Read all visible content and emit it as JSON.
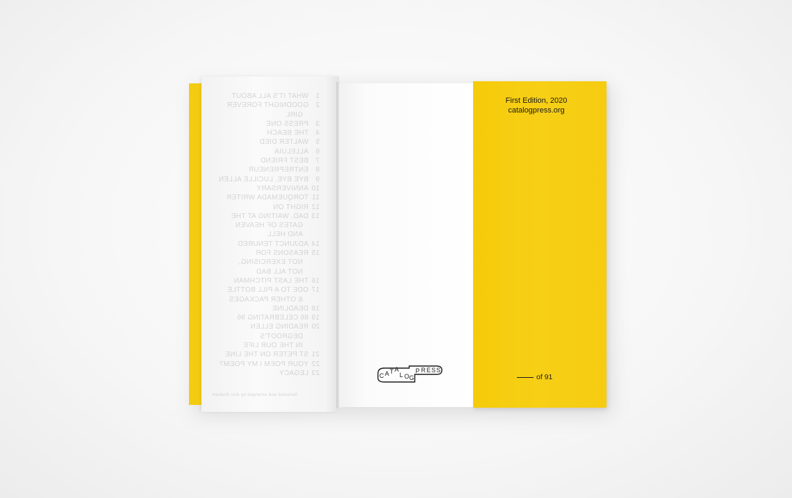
{
  "image": {
    "description_colors": {
      "background": "#f7f7f7",
      "cover_yellow": "#f5cc10",
      "paper": "#fbfbfb",
      "ink": "#1a1a1a"
    }
  },
  "colophon": {
    "edition": "First Edition, 2020",
    "website": "catalogpress.org",
    "copy_count_suffix": "of 91"
  },
  "logo": {
    "letters": [
      "C",
      "A",
      "T",
      "A",
      "L",
      "O",
      "G",
      "P",
      "R",
      "E",
      "S",
      "S"
    ]
  },
  "contents_showthrough": {
    "rows": [
      {
        "num": "1",
        "title": "WHAT IT'S ALL ABOUT"
      },
      {
        "num": "2",
        "title": "GOODNIGHT FOREVER"
      },
      {
        "num": "",
        "title": "GIRL"
      },
      {
        "num": "3",
        "title": "PRESS ONE"
      },
      {
        "num": "4",
        "title": "THE BEACH"
      },
      {
        "num": "5",
        "title": "WALTER DIED"
      },
      {
        "num": "6",
        "title": "ALLELUIA"
      },
      {
        "num": "7",
        "title": "BEST FRIEND"
      },
      {
        "num": "8",
        "title": "ENTREPRENEUR"
      },
      {
        "num": "9",
        "title": "BYE BYE, LUCILLE ALLEN"
      },
      {
        "num": "10",
        "title": "ANNIVERSARY"
      },
      {
        "num": "11",
        "title": "TORQUEMADA WRITER"
      },
      {
        "num": "12",
        "title": "RIGHT ON"
      },
      {
        "num": "13",
        "title": "DAD, WAITING AT THE"
      },
      {
        "num": "",
        "title": "GATES OF HEAVEN"
      },
      {
        "num": "",
        "title": "AND HELL"
      },
      {
        "num": "14",
        "title": "ADJUNCT TENURED"
      },
      {
        "num": "15",
        "title": "REASONS FOR"
      },
      {
        "num": "",
        "title": "NOT EXERCISING,"
      },
      {
        "num": "",
        "title": "NOT ALL BAD"
      },
      {
        "num": "16",
        "title": "THE LAST PITCHMAN"
      },
      {
        "num": "17",
        "title": "ODE TO A PILL BOTTLE"
      },
      {
        "num": "",
        "title": "& OTHER PACKAGES"
      },
      {
        "num": "18",
        "title": "DEADLINE"
      },
      {
        "num": "19",
        "title": "86 CELEBRATING 96"
      },
      {
        "num": "20",
        "title": "READING ELLEN"
      },
      {
        "num": "",
        "title": "DEGROOT'S"
      },
      {
        "num": "",
        "title": "IN THE OUR LIFE"
      },
      {
        "num": "21",
        "title": "ST PETER ON THE LINE"
      },
      {
        "num": "22",
        "title": "YOUR POEM I MY POEM?"
      },
      {
        "num": "23",
        "title": "LEGACY"
      }
    ],
    "credit": "Selected and arranged by Ann Graham"
  }
}
